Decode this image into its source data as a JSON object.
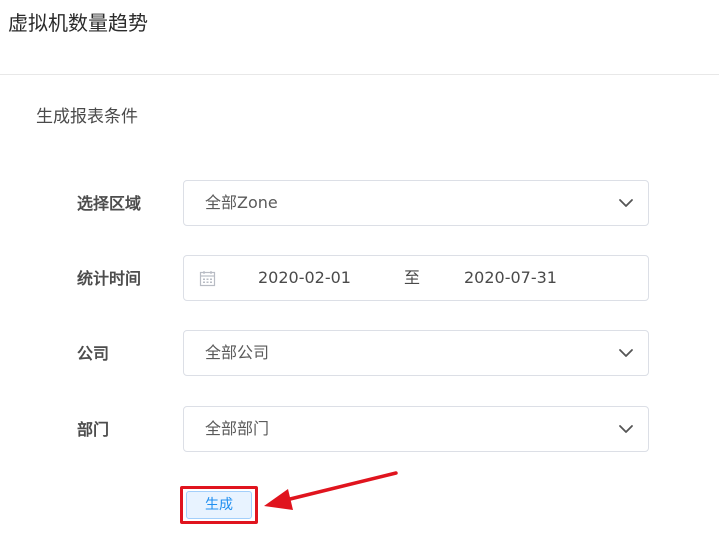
{
  "header": {
    "title": "虚拟机数量趋势"
  },
  "section": {
    "title": "生成报表条件"
  },
  "form": {
    "region": {
      "label": "选择区域",
      "value": "全部Zone"
    },
    "period": {
      "label": "统计时间",
      "start": "2020-02-01",
      "separator": "至",
      "end": "2020-07-31"
    },
    "company": {
      "label": "公司",
      "value": "全部公司"
    },
    "department": {
      "label": "部门",
      "value": "全部部门"
    }
  },
  "actions": {
    "generate_label": "生成"
  },
  "colors": {
    "highlight": "#e0141e",
    "primary": "#1f8ff0",
    "border": "#dcdfe6"
  },
  "icons": {
    "select": "chevron-down-icon",
    "date": "calendar-icon",
    "annotation": "red-arrow-icon"
  }
}
